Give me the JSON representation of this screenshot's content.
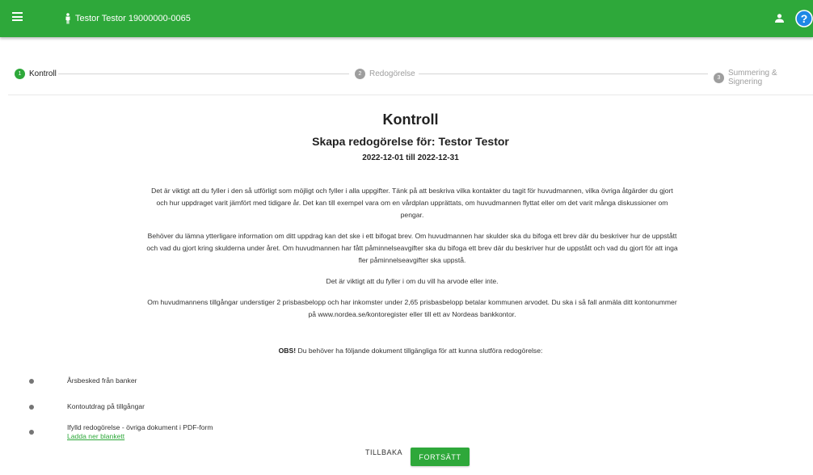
{
  "topbar": {
    "user": "Testor Testor 19000000-0065",
    "menu_icon": "hamburger-menu-icon",
    "person_icon": "person-icon",
    "account_icon": "account-icon",
    "help_icon": "help-icon",
    "help_glyph": "?",
    "color": "#2ea83a"
  },
  "stepper": {
    "steps": [
      {
        "number": "1",
        "label": "Kontroll",
        "active": true
      },
      {
        "number": "2",
        "label": "Redogörelse",
        "active": false
      },
      {
        "number": "3",
        "label": "Summering & Signering",
        "active": false
      }
    ]
  },
  "main": {
    "title": "Kontroll",
    "subtitle": "Skapa redogörelse för: Testor Testor",
    "period": "2022-12-01 till 2022-12-31",
    "paragraphs": [
      "Det är viktigt att du fyller i den så utförligt som möjligt och fyller i alla uppgifter. Tänk på att beskriva vilka kontakter du tagit för huvudmannen, vilka övriga åtgärder du gjort och hur uppdraget varit jämfört med tidigare år. Det kan till exempel vara om en vårdplan upprättats, om huvudmannen flyttat eller om det varit många diskussioner om pengar.",
      "Behöver du lämna ytterligare information om ditt uppdrag kan det ske i ett bifogat brev. Om huvudmannen har skulder ska du bifoga ett brev där du beskriver hur de uppstått och vad du gjort kring skulderna under året. Om huvudmannen har fått påminnelseavgifter ska du bifoga ett brev där du beskriver hur de uppstått och vad du gjort för att inga fler påminnelseavgifter ska uppstå.",
      "Det är viktigt att du fyller i om du vill ha arvode eller inte.",
      "Om huvudmannens tillgångar understiger 2 prisbasbelopp och har inkomster under 2,65 prisbasbelopp betalar kommunen arvodet. Du ska i så fall anmäla ditt kontonummer på www.nordea.se/kontoregister eller till ett av Nordeas bankkontor."
    ],
    "obs_bold": "OBS!",
    "obs_text": " Du behöver ha följande dokument tillgängliga för att kunna slutföra redogörelse:",
    "documents": [
      {
        "label": "Årsbesked från banker"
      },
      {
        "label": "Kontoutdrag på tillgångar"
      },
      {
        "label": "Ifylld redogörelse - övriga dokument i PDF-form",
        "link": "Ladda ner blankett"
      }
    ],
    "back_label": "TILLBAKA",
    "next_label": "FORTSÄTT"
  }
}
